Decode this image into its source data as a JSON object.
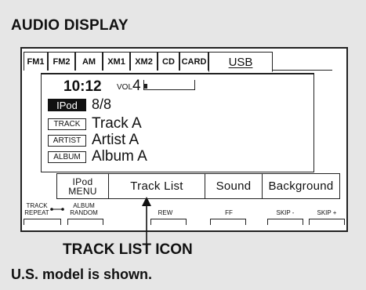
{
  "heading": "AUDIO DISPLAY",
  "tabs": [
    "FM1",
    "FM2",
    "AM",
    "XM1",
    "XM2",
    "CD",
    "CARD",
    "USB"
  ],
  "selected_tab": "USB",
  "status": {
    "time": "10:12",
    "vol_label": "VOL",
    "vol_value": "4",
    "vol_level": 0.07
  },
  "source": {
    "badge": "IPod",
    "count": "8/8"
  },
  "rows": [
    {
      "tag": "TRACK",
      "value": "Track A"
    },
    {
      "tag": "ARTIST",
      "value": "Artist A"
    },
    {
      "tag": "ALBUM",
      "value": "Album A"
    }
  ],
  "softkeys": {
    "ipod_line1": "IPod",
    "ipod_line2": "MENU",
    "track_list": "Track List",
    "sound": "Sound",
    "background": "Background"
  },
  "hardware_buttons": {
    "track_repeat_1": "TRACK",
    "track_repeat_2": "REPEAT",
    "album_random_1": "ALBUM",
    "album_random_2": "RANDOM",
    "rew": "REW",
    "ff": "FF",
    "skip_minus": "SKIP -",
    "skip_plus": "SKIP +"
  },
  "caption": "TRACK LIST ICON",
  "footnote": "U.S. model is shown."
}
